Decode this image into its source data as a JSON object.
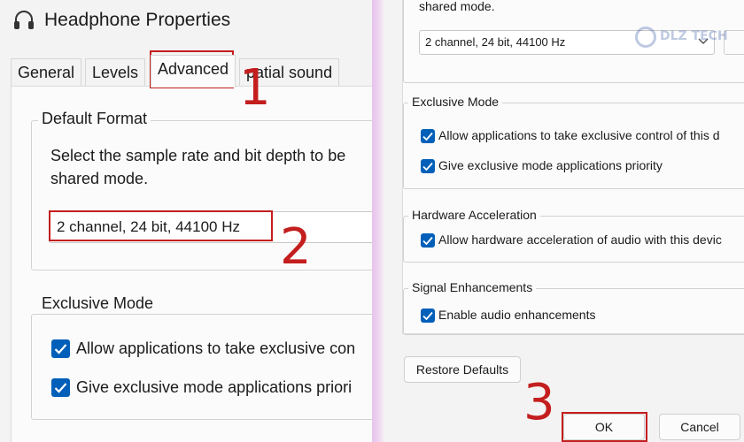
{
  "window": {
    "title": "Headphone Properties",
    "icon": "headphones-icon"
  },
  "tabs": [
    {
      "label": "General"
    },
    {
      "label": "Levels"
    },
    {
      "label": "Advanced",
      "active": true
    },
    {
      "label": "Spatial sound",
      "visible_text": "patial sound"
    }
  ],
  "left_panel": {
    "default_format": {
      "legend": "Default Format",
      "description_line1": "Select the sample rate and bit depth to be",
      "description_line2": "shared mode.",
      "selected_format": "2 channel, 24 bit, 44100 Hz"
    },
    "exclusive_mode": {
      "legend": "Exclusive Mode",
      "options": [
        {
          "label": "Allow applications to take exclusive con",
          "checked": true
        },
        {
          "label": "Give exclusive mode applications priori",
          "checked": true
        }
      ]
    }
  },
  "right_panel": {
    "top_desc": "shared mode.",
    "selected_format": "2 channel, 24 bit, 44100 Hz",
    "exclusive_mode": {
      "legend": "Exclusive Mode",
      "options": [
        {
          "label": "Allow applications to take exclusive control of this d",
          "checked": true
        },
        {
          "label": "Give exclusive mode applications priority",
          "checked": true
        }
      ]
    },
    "hardware_acceleration": {
      "legend": "Hardware Acceleration",
      "options": [
        {
          "label": "Allow hardware acceleration of audio with this devic",
          "checked": true
        }
      ]
    },
    "signal_enhancements": {
      "legend": "Signal Enhancements",
      "options": [
        {
          "label": "Enable audio enhancements",
          "checked": true
        }
      ]
    },
    "restore_defaults_label": "Restore Defaults",
    "ok_label": "OK",
    "cancel_label": "Cancel",
    "watermark_text": "DLZ TECH"
  },
  "annotations": {
    "step1": "1",
    "step2": "2",
    "step3": "3",
    "color": "#c41e1e"
  },
  "colors": {
    "accent": "#005fb8",
    "annotation": "#c41e1e",
    "window_bg": "#f3f3f3",
    "content_bg": "#fbfbfb"
  }
}
